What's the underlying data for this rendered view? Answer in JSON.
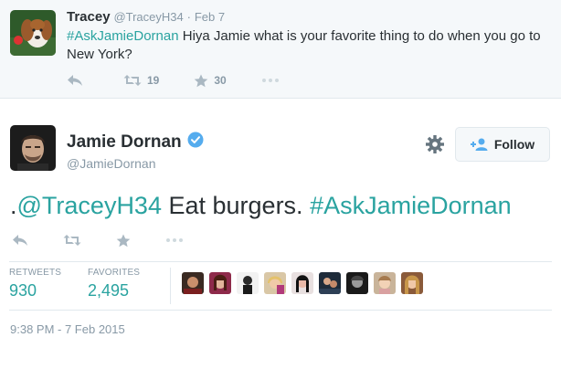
{
  "parent_tweet": {
    "name": "Tracey",
    "handle": "@TraceyH34",
    "separator": "·",
    "date": "Feb 7",
    "hashtag": "#AskJamieDornan",
    "text": " Hiya Jamie what is your favorite thing to do when you go to New York?",
    "retweet_count": "19",
    "favorite_count": "30"
  },
  "main_tweet": {
    "name": "Jamie Dornan",
    "handle": "@JamieDornan",
    "follow_label": "Follow",
    "text_prefix": ".",
    "mention": "@TraceyH34",
    "text_middle": " Eat burgers. ",
    "hashtag": "#AskJamieDornan",
    "retweets_label": "RETWEETS",
    "retweets_value": "930",
    "favorites_label": "FAVORITES",
    "favorites_value": "2,495",
    "timestamp": "9:38 PM - 7 Feb 2015"
  },
  "colors": {
    "accent": "#2aa3a0",
    "muted": "#8899a6",
    "icon": "#aab8c2",
    "verified": "#55acee"
  },
  "icons": [
    "reply-icon",
    "retweet-icon",
    "star-icon",
    "more-icon",
    "verified-icon",
    "gear-icon",
    "add-user-icon"
  ]
}
